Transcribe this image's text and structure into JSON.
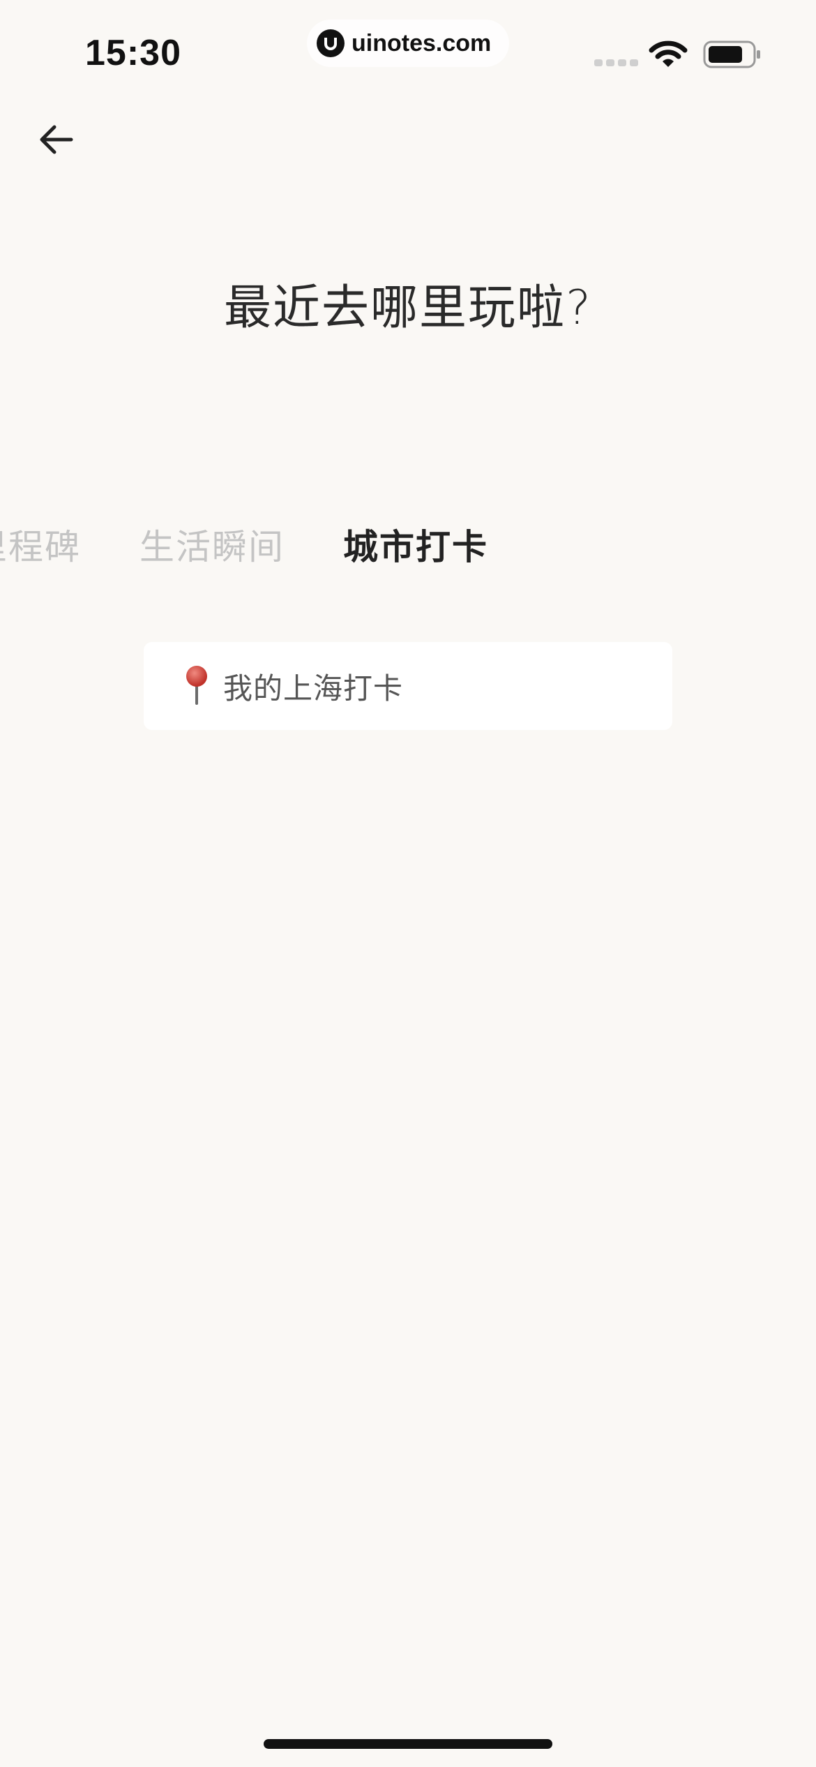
{
  "status_bar": {
    "time": "15:30",
    "watermark": "uinotes.com"
  },
  "icons": {
    "back": "arrow-left-icon",
    "location": "round-pushpin-icon"
  },
  "page": {
    "heading": "最近去哪里玩啦?"
  },
  "tabs": [
    {
      "label": "里程碑",
      "active": false
    },
    {
      "label": "生活瞬间",
      "active": false
    },
    {
      "label": "城市打卡",
      "active": true
    }
  ],
  "location_card": {
    "label": "我的上海打卡"
  },
  "colors": {
    "background": "#faf8f5",
    "active_tab": "#222222",
    "inactive_tab": "#c4c4c4",
    "pin": "#d9463b"
  }
}
